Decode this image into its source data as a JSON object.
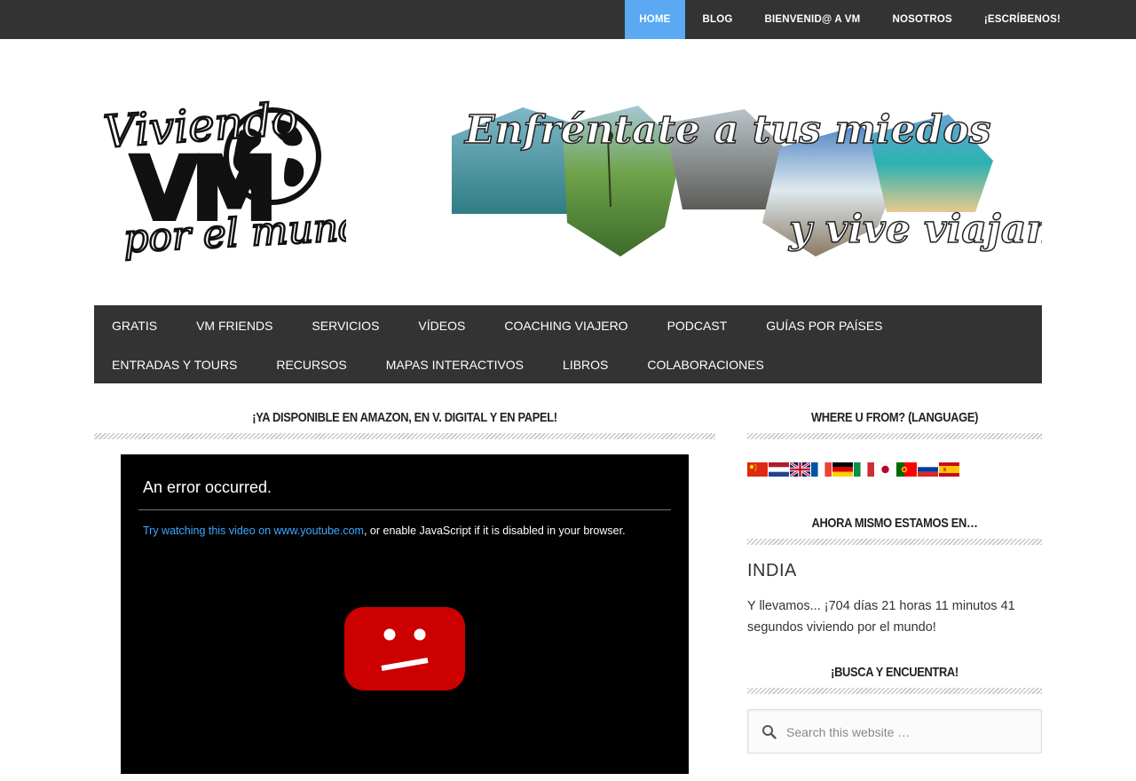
{
  "top_nav": {
    "items": [
      "HOME",
      "BLOG",
      "BIENVENID@ A VM",
      "NOSOTROS",
      "¡ESCRÍBENOS!"
    ]
  },
  "header": {
    "logo_text": {
      "line1": "Viviendo",
      "line2": "VM",
      "line3": "por el mundo"
    },
    "banner_text": {
      "line1": "Enfréntate a tus miedos",
      "line2": "y vive viajando"
    }
  },
  "main_nav": {
    "row1": [
      "GRATIS",
      "VM FRIENDS",
      "SERVICIOS",
      "VÍDEOS",
      "COACHING VIAJERO",
      "PODCAST",
      "GUÍAS POR PAÍSES"
    ],
    "row2": [
      "ENTRADAS Y TOURS",
      "RECURSOS",
      "MAPAS INTERACTIVOS",
      "LIBROS",
      "COLABORACIONES"
    ]
  },
  "content": {
    "title": "¡YA DISPONIBLE EN AMAZON, EN V. DIGITAL Y EN PAPEL!",
    "video": {
      "error_title": "An error occurred.",
      "link_text": "Try watching this video on www.youtube.com",
      "message_rest": ", or enable JavaScript if it is disabled in your browser."
    }
  },
  "sidebar": {
    "language_title": "WHERE U FROM? (LANGUAGE)",
    "flags": [
      "chinese-flag-icon",
      "dutch-flag-icon",
      "english-flag-icon",
      "french-flag-icon",
      "german-flag-icon",
      "italian-flag-icon",
      "japanese-flag-icon",
      "portuguese-flag-icon",
      "russian-flag-icon",
      "spanish-flag-icon"
    ],
    "location_title": "AHORA MISMO ESTAMOS EN…",
    "location": "INDIA",
    "counter_text": "Y llevamos... ¡704 días 21 horas 11 minutos 41 segundos viviendo por el mundo!",
    "search_title": "¡BUSCA Y ENCUENTRA!",
    "search_placeholder": "Search this website …"
  },
  "colors": {
    "topbar": "#333333",
    "active": "#5aa9f2",
    "nav": "#333333",
    "youtube_red": "#cc0000"
  }
}
